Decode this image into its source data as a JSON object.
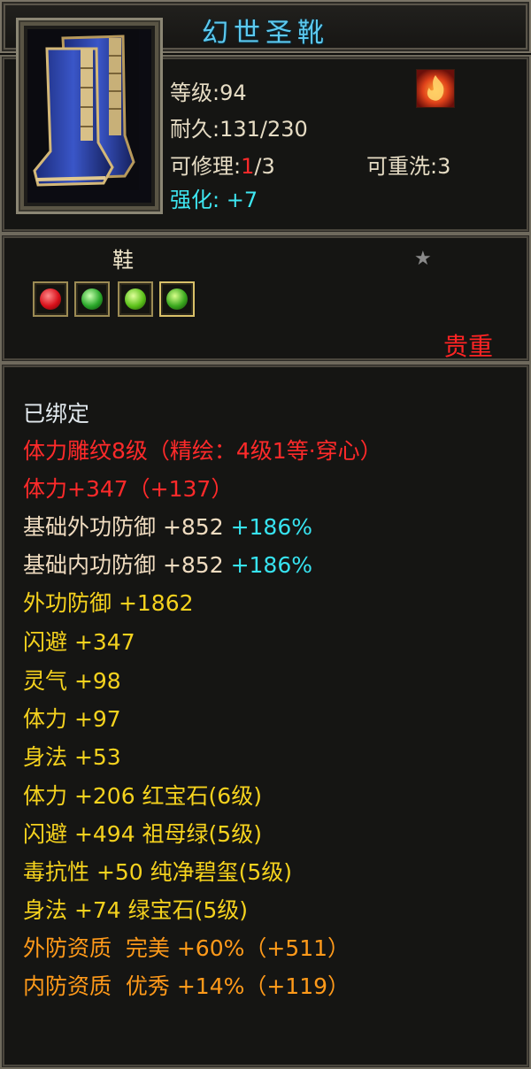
{
  "title": "幻世圣靴",
  "header": {
    "level": "等级:94",
    "durability": "耐久:131/230",
    "repair_prefix": "可修理:",
    "repair_current": "1",
    "repair_suffix": "/3",
    "rewash": "可重洗:3",
    "enhance_label": "强化:",
    "enhance_value": "+7",
    "item_icon": "blue-boots-icon",
    "rarity_icon": "flame-emblem-icon"
  },
  "middle": {
    "type": "鞋",
    "star_icon": "star-icon",
    "rarity": "贵重",
    "gems": [
      "red-gem-icon",
      "green-gem-icon",
      "green-gem-icon",
      "green-gem-icon"
    ]
  },
  "attributes": {
    "bound": "已绑定",
    "engrave": "体力雕纹8级（精绘：4级1等·穿心）",
    "stamina_main": "体力+347（+137）",
    "base_outer_def": "基础外功防御 +852",
    "base_outer_def_pct": "+186%",
    "base_inner_def": "基础内功防御 +852",
    "base_inner_def_pct": "+186%",
    "outer_def": "外功防御 +1862",
    "dodge": "闪避 +347",
    "spirit": "灵气 +98",
    "stamina": "体力 +97",
    "agility": "身法 +53",
    "gem_stamina": "体力 +206 红宝石(6级)",
    "gem_dodge": "闪避 +494 祖母绿(5级)",
    "gem_poison": "毒抗性 +50 纯净碧玺(5级)",
    "gem_agility": "身法 +74 绿宝石(5级)",
    "outer_aptitude": "外防资质  完美 +60%（+511）",
    "inner_aptitude": "内防资质  优秀 +14%（+119）"
  }
}
